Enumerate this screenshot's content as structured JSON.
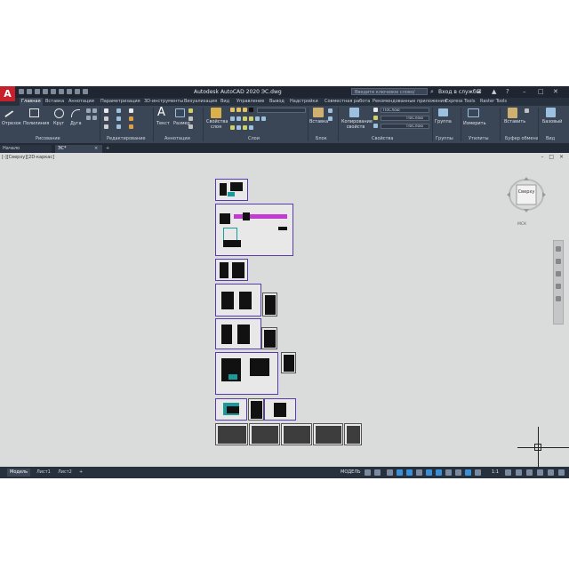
{
  "title_bar": {
    "app_title": "Autodesk AutoCAD 2020   ЭС.dwg",
    "search_placeholder": "Введите ключевое слово/фразу",
    "sign_in": "Вход в службы"
  },
  "ribbon_tabs": [
    "Главная",
    "Вставка",
    "Аннотации",
    "Параметризация",
    "3D-инструменты",
    "Визуализация",
    "Вид",
    "Управление",
    "Вывод",
    "Надстройки",
    "Совместная работа",
    "Рекомендованные приложения",
    "Express Tools",
    "Raster Tools"
  ],
  "ribbon": {
    "draw_tools": [
      "Отрезок",
      "Полилиния",
      "Круг",
      "Дуга"
    ],
    "text": "Текст",
    "dimension": "Размер",
    "layer_props": "Свойства слоя",
    "insert": "Вставка",
    "match_props": "Копирование свойств",
    "group": "Группа",
    "measure": "Измерить",
    "paste": "Вставить",
    "base": "Базовый",
    "bylayer_1": "ПоСлою",
    "bylayer_2": "ПоСлою",
    "bylayer_3": "ПоСлою",
    "panels": [
      "Рисование",
      "Редактирование",
      "Аннотации",
      "Слои",
      "Блок",
      "Свойства",
      "Группы",
      "Утилиты",
      "Буфер обмена",
      "Вид"
    ]
  },
  "file_tabs": [
    "Начало",
    "ЭС*"
  ],
  "viewport": {
    "label": "[-][Сверху][2D-каркас]",
    "viewcube_label": "Сверху",
    "wcs": "МСК"
  },
  "layout_tabs": [
    "Модель",
    "Лист1",
    "Лист2"
  ],
  "status": {
    "model": "МОДЕЛЬ",
    "scale": "1:1"
  }
}
